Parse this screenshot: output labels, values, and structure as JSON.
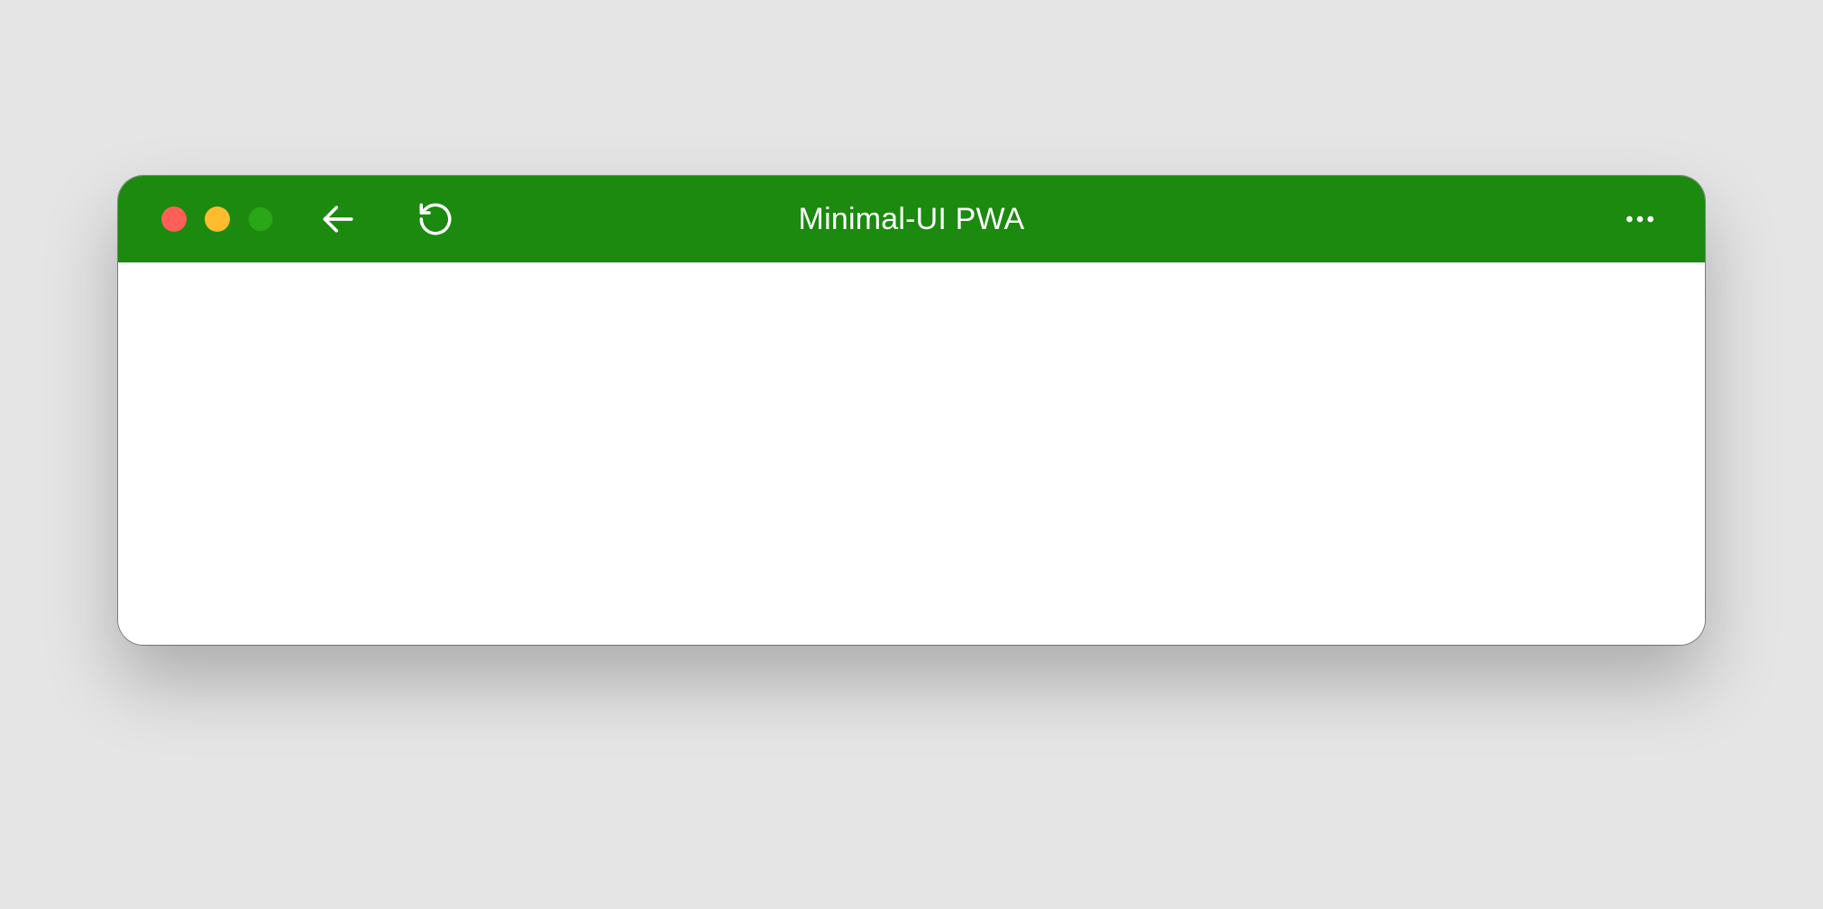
{
  "window": {
    "title": "Minimal-UI PWA",
    "theme_color": "#1b8a0f",
    "traffic_lights": {
      "close": "#ff5f57",
      "minimize": "#febc2e",
      "maximize": "#2aa716"
    },
    "controls": {
      "back_icon": "arrow-left",
      "reload_icon": "reload",
      "more_icon": "more-horizontal"
    }
  }
}
